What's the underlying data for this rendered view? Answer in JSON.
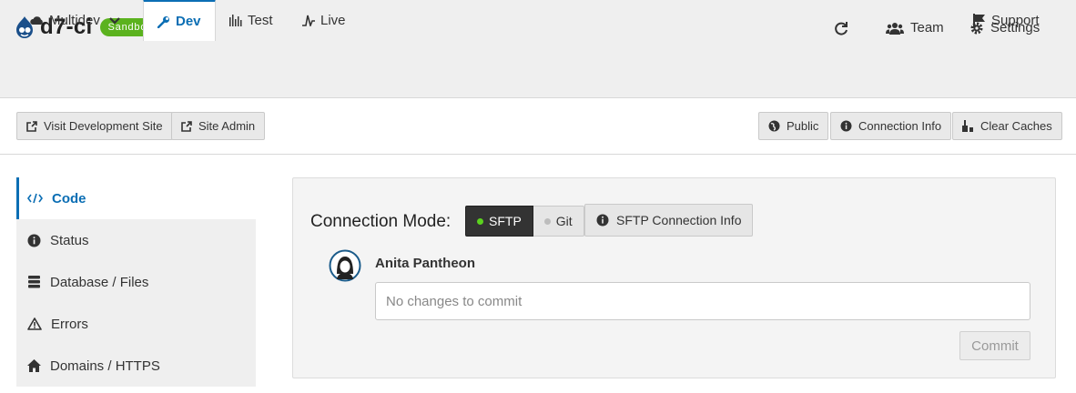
{
  "header": {
    "site_name": "d7-ci",
    "badge": "Sandbox",
    "refresh_icon": "refresh-icon",
    "team_label": "Team",
    "settings_label": "Settings"
  },
  "env_tabs": {
    "multidev": "Multidev",
    "dev": "Dev",
    "test": "Test",
    "live": "Live",
    "support": "Support"
  },
  "toolbar": {
    "visit_site": "Visit Development Site",
    "site_admin": "Site Admin",
    "public": "Public",
    "connection_info": "Connection Info",
    "clear_caches": "Clear Caches"
  },
  "sidenav": {
    "items": [
      {
        "label": "Code",
        "icon": "code-icon",
        "active": true
      },
      {
        "label": "Status",
        "icon": "info-icon"
      },
      {
        "label": "Database / Files",
        "icon": "database-icon"
      },
      {
        "label": "Errors",
        "icon": "warning-icon"
      },
      {
        "label": "Domains / HTTPS",
        "icon": "home-icon"
      }
    ]
  },
  "code_panel": {
    "connection_mode_label": "Connection Mode:",
    "mode_sftp": "SFTP",
    "mode_git": "Git",
    "selected_mode": "SFTP",
    "sftp_info_button": "SFTP Connection Info",
    "user_name": "Anita Pantheon",
    "commit_placeholder": "No changes to commit",
    "commit_value": "",
    "commit_button": "Commit"
  },
  "colors": {
    "accent": "#0b6eb4",
    "sandbox_badge": "#5bb21e",
    "sftp_active_dot": "#5bd21e"
  }
}
